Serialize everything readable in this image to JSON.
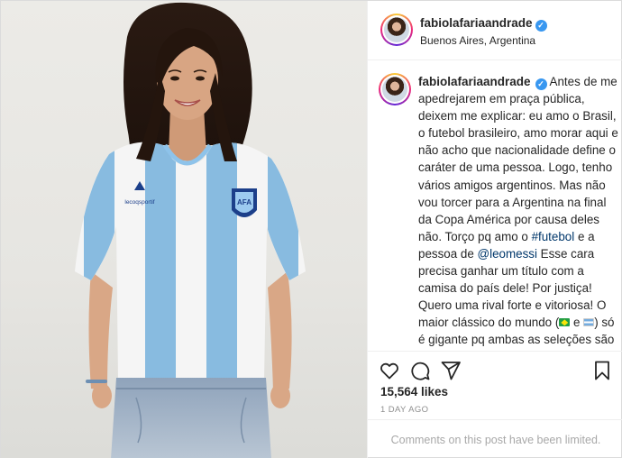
{
  "post": {
    "username": "fabiolafariaandrade",
    "location": "Buenos Aires, Argentina",
    "caption": {
      "t1": "Antes de me apedrejarem em praça pública, deixem me explicar: eu amo o Brasil, o futebol brasileiro, amo morar aqui e não acho que nacionalidade define o caráter de uma pessoa. Logo, tenho vários amigos argentinos. Mas não vou torcer para a Argentina na final da Copa América por causa deles não. Torço pq amo o ",
      "hashtag": "#futebol",
      "t2": " e a pessoa de ",
      "mention": "@leomessi",
      "t3": " Esse cara precisa ganhar um título com a camisa do país dele! Por justiça! Quero uma rival forte e vitoriosa! O maior clássico do mundo (",
      "t4": " e ",
      "t5": ") só é gigante pq ambas as seleções são gigantes... \"ah, Fabíola, duvido que tenha um argentino que torça para o Brasil...\" E eu (alguma vez na vida) fiz algo pq outra pessoa fez ou deixou de fazer? Sigo sempre meu coração."
    },
    "likes": "15,564 likes",
    "date": "1 DAY AGO",
    "comments_limited": "Comments on this post have been limited.",
    "jersey_brand": "lecoqsportif",
    "crest_text": "AFA"
  },
  "icons": {
    "verified": "verified-badge-icon",
    "like": "heart-icon",
    "comment": "comment-bubble-icon",
    "share": "paper-plane-icon",
    "save": "bookmark-icon",
    "flag_brazil": "brazil-flag-icon",
    "flag_argentina": "argentina-flag-icon"
  },
  "colors": {
    "verified": "#3897f0",
    "link": "#00376b",
    "muted": "#8e8e8e",
    "jersey_stripe": "#8ec3ea"
  }
}
